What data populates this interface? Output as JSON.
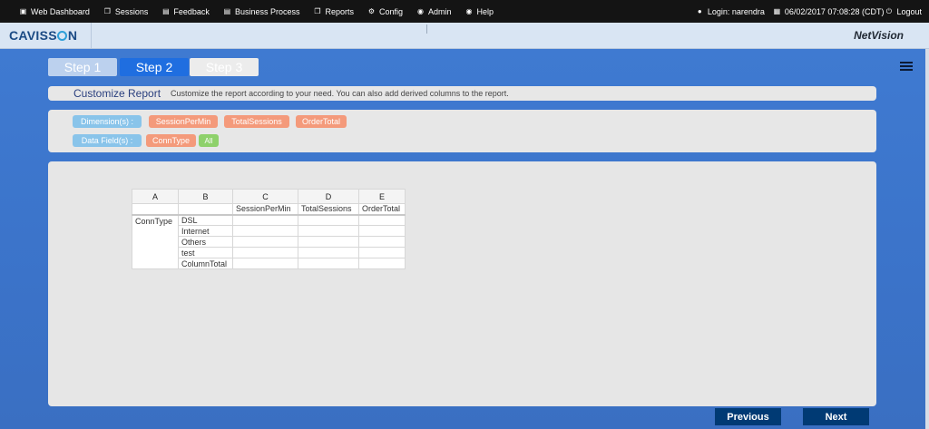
{
  "topnav": {
    "items": [
      {
        "label": "Web Dashboard",
        "icon": "dashboard-icon",
        "glyph": "▣"
      },
      {
        "label": "Sessions",
        "icon": "sessions-icon",
        "glyph": "❐"
      },
      {
        "label": "Feedback",
        "icon": "feedback-icon",
        "glyph": "▤"
      },
      {
        "label": "Business Process",
        "icon": "business-process-icon",
        "glyph": "▤"
      },
      {
        "label": "Reports",
        "icon": "reports-icon",
        "glyph": "❐"
      },
      {
        "label": "Config",
        "icon": "config-icon",
        "glyph": "⚙"
      },
      {
        "label": "Admin",
        "icon": "admin-icon",
        "glyph": "◉"
      },
      {
        "label": "Help",
        "icon": "help-icon",
        "glyph": "◉"
      }
    ],
    "login": "Login: narendra",
    "datetime": "06/02/2017 07:08:28 (CDT)",
    "logout": "Logout"
  },
  "brand": {
    "logo_pre": "CAVISS",
    "logo_post": "N",
    "product": "NetVision"
  },
  "steps": [
    "Step 1",
    "Step 2",
    "Step 3"
  ],
  "report": {
    "title": "Customize Report",
    "description": "Customize the report according to your need. You can also add derived columns to the report."
  },
  "dimensions": {
    "label": "Dimension(s) :",
    "values": [
      "SessionPerMin",
      "TotalSessions",
      "OrderTotal"
    ]
  },
  "data_fields": {
    "label": "Data Field(s) :",
    "values": [
      "ConnType"
    ],
    "all_badge": "All"
  },
  "sheet": {
    "column_letters": [
      "A",
      "B",
      "C",
      "D",
      "E"
    ],
    "headers": [
      "",
      "",
      "SessionPerMin",
      "TotalSessions",
      "OrderTotal"
    ],
    "group_label": "ConnType",
    "rows": [
      "DSL",
      "Internet",
      "Others",
      "test",
      "ColumnTotal"
    ]
  },
  "buttons": {
    "previous": "Previous",
    "next": "Next"
  }
}
